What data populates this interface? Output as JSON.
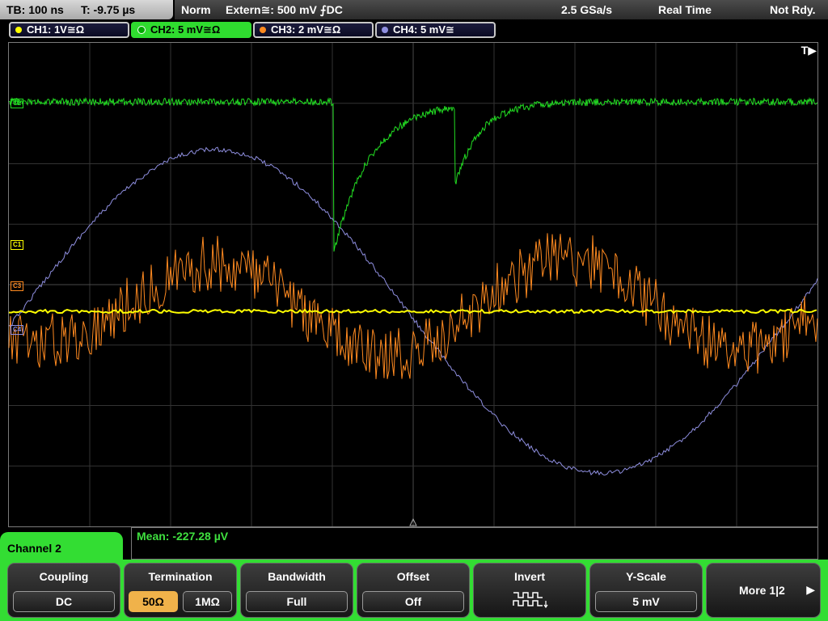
{
  "status": {
    "timebase": "TB: 100 ns",
    "trigger_time": "T: -9.75 µs",
    "mode": "Norm",
    "trigger_source": "Extern≅: 500 mV ⨍DC",
    "sample_rate": "2.5 GSa/s",
    "acq_mode": "Real Time",
    "state": "Not Rdy."
  },
  "channels": [
    {
      "label": "CH1: 1V≅Ω",
      "color": "#ffff00",
      "marker": "C1"
    },
    {
      "label": "CH2: 5 mV≅Ω",
      "color": "#22dd22",
      "marker": "C2"
    },
    {
      "label": "CH3: 2 mV≅Ω",
      "color": "#ff8a20",
      "marker": "C3"
    },
    {
      "label": "CH4: 5 mV≅",
      "color": "#8f8fe0",
      "marker": "C4"
    }
  ],
  "trigger_marker": "T▶",
  "measurement": "Mean: -227.28 µV",
  "menu": {
    "title": "Channel 2",
    "coupling": {
      "title": "Coupling",
      "value": "DC"
    },
    "termination": {
      "title": "Termination",
      "options": [
        "50Ω",
        "1MΩ"
      ],
      "selected": "50Ω"
    },
    "bandwidth": {
      "title": "Bandwidth",
      "value": "Full"
    },
    "offset": {
      "title": "Offset",
      "value": "Off"
    },
    "invert": {
      "title": "Invert",
      "icon": "invert-waveform-icon"
    },
    "yscale": {
      "title": "Y-Scale",
      "value": "5 mV"
    },
    "more": {
      "label": "More 1|2",
      "icon": "right-arrow-icon"
    }
  },
  "icons": {
    "channel-dot": "circle",
    "trigger": "T▶",
    "more": "▶"
  }
}
